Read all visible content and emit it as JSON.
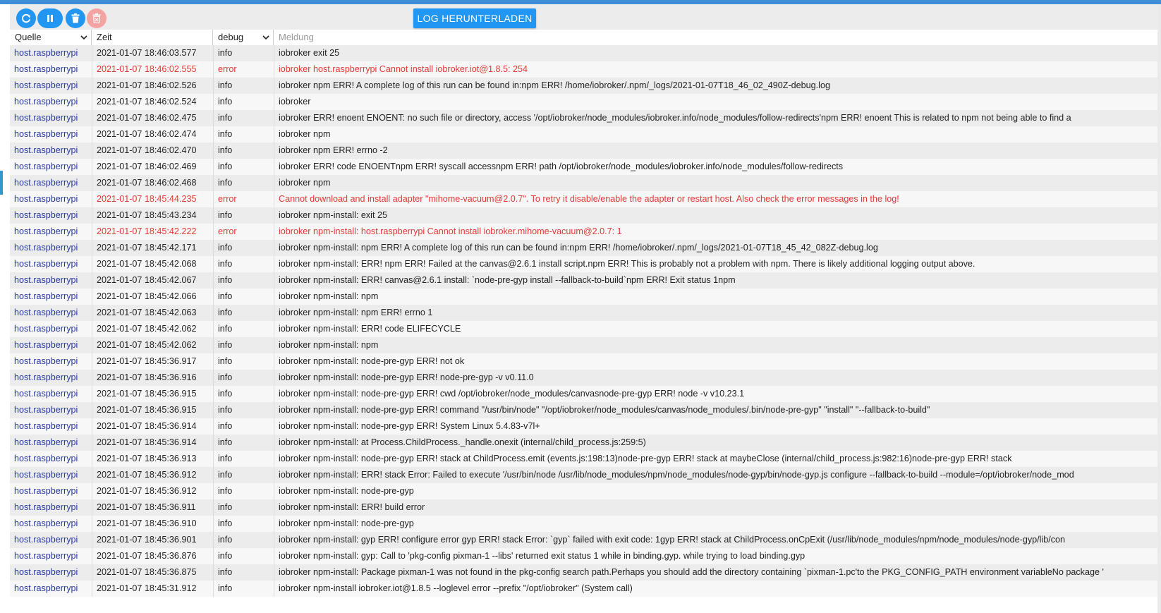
{
  "toolbar": {
    "buttons": [
      {
        "name": "refresh",
        "icon": "refresh-icon"
      },
      {
        "name": "pause",
        "icon": "pause-icon"
      },
      {
        "name": "delete",
        "icon": "trash-icon"
      },
      {
        "name": "delete-file",
        "icon": "trash-x-icon",
        "disabled": true
      }
    ],
    "download_label": "LOG HERUNTERLADEN"
  },
  "table": {
    "columns": {
      "source": "Quelle",
      "time": "Zeit",
      "severity": "debug",
      "message_placeholder": "Meldung"
    },
    "rows": [
      {
        "source": "host.raspberrypi",
        "time": "2021-01-07 18:46:03.577",
        "severity": "info",
        "message": "iobroker exit 25"
      },
      {
        "source": "host.raspberrypi",
        "time": "2021-01-07 18:46:02.555",
        "severity": "error",
        "message": "iobroker host.raspberrypi Cannot install iobroker.iot@1.8.5: 254"
      },
      {
        "source": "host.raspberrypi",
        "time": "2021-01-07 18:46:02.526",
        "severity": "info",
        "message": "iobroker npm ERR! A complete log of this run can be found in:npm ERR! /home/iobroker/.npm/_logs/2021-01-07T18_46_02_490Z-debug.log"
      },
      {
        "source": "host.raspberrypi",
        "time": "2021-01-07 18:46:02.524",
        "severity": "info",
        "message": "iobroker"
      },
      {
        "source": "host.raspberrypi",
        "time": "2021-01-07 18:46:02.475",
        "severity": "info",
        "message": "iobroker ERR! enoent ENOENT: no such file or directory, access '/opt/iobroker/node_modules/iobroker.info/node_modules/follow-redirects'npm ERR! enoent This is related to npm not being able to find a"
      },
      {
        "source": "host.raspberrypi",
        "time": "2021-01-07 18:46:02.474",
        "severity": "info",
        "message": "iobroker npm"
      },
      {
        "source": "host.raspberrypi",
        "time": "2021-01-07 18:46:02.470",
        "severity": "info",
        "message": "iobroker npm ERR! errno -2"
      },
      {
        "source": "host.raspberrypi",
        "time": "2021-01-07 18:46:02.469",
        "severity": "info",
        "message": "iobroker ERR! code ENOENTnpm ERR! syscall accessnpm ERR! path /opt/iobroker/node_modules/iobroker.info/node_modules/follow-redirects"
      },
      {
        "source": "host.raspberrypi",
        "time": "2021-01-07 18:46:02.468",
        "severity": "info",
        "message": "iobroker npm"
      },
      {
        "source": "host.raspberrypi",
        "time": "2021-01-07 18:45:44.235",
        "severity": "error",
        "message": "Cannot download and install adapter \"mihome-vacuum@2.0.7\". To retry it disable/enable the adapter or restart host. Also check the error messages in the log!"
      },
      {
        "source": "host.raspberrypi",
        "time": "2021-01-07 18:45:43.234",
        "severity": "info",
        "message": "iobroker npm-install: exit 25"
      },
      {
        "source": "host.raspberrypi",
        "time": "2021-01-07 18:45:42.222",
        "severity": "error",
        "message": "iobroker npm-install: host.raspberrypi Cannot install iobroker.mihome-vacuum@2.0.7: 1"
      },
      {
        "source": "host.raspberrypi",
        "time": "2021-01-07 18:45:42.171",
        "severity": "info",
        "message": "iobroker npm-install: npm ERR! A complete log of this run can be found in:npm ERR! /home/iobroker/.npm/_logs/2021-01-07T18_45_42_082Z-debug.log"
      },
      {
        "source": "host.raspberrypi",
        "time": "2021-01-07 18:45:42.068",
        "severity": "info",
        "message": "iobroker npm-install: ERR! npm ERR! Failed at the canvas@2.6.1 install script.npm ERR! This is probably not a problem with npm. There is likely additional logging output above."
      },
      {
        "source": "host.raspberrypi",
        "time": "2021-01-07 18:45:42.067",
        "severity": "info",
        "message": "iobroker npm-install: ERR! canvas@2.6.1 install: `node-pre-gyp install --fallback-to-build`npm ERR! Exit status 1npm"
      },
      {
        "source": "host.raspberrypi",
        "time": "2021-01-07 18:45:42.066",
        "severity": "info",
        "message": "iobroker npm-install: npm"
      },
      {
        "source": "host.raspberrypi",
        "time": "2021-01-07 18:45:42.063",
        "severity": "info",
        "message": "iobroker npm-install: npm ERR! errno 1"
      },
      {
        "source": "host.raspberrypi",
        "time": "2021-01-07 18:45:42.062",
        "severity": "info",
        "message": "iobroker npm-install: ERR! code ELIFECYCLE"
      },
      {
        "source": "host.raspberrypi",
        "time": "2021-01-07 18:45:42.062",
        "severity": "info",
        "message": "iobroker npm-install: npm"
      },
      {
        "source": "host.raspberrypi",
        "time": "2021-01-07 18:45:36.917",
        "severity": "info",
        "message": "iobroker npm-install: node-pre-gyp ERR! not ok"
      },
      {
        "source": "host.raspberrypi",
        "time": "2021-01-07 18:45:36.916",
        "severity": "info",
        "message": "iobroker npm-install: node-pre-gyp ERR! node-pre-gyp -v v0.11.0"
      },
      {
        "source": "host.raspberrypi",
        "time": "2021-01-07 18:45:36.915",
        "severity": "info",
        "message": "iobroker npm-install: node-pre-gyp ERR! cwd /opt/iobroker/node_modules/canvasnode-pre-gyp ERR! node -v v10.23.1"
      },
      {
        "source": "host.raspberrypi",
        "time": "2021-01-07 18:45:36.915",
        "severity": "info",
        "message": "iobroker npm-install: node-pre-gyp ERR! command \"/usr/bin/node\" \"/opt/iobroker/node_modules/canvas/node_modules/.bin/node-pre-gyp\" \"install\" \"--fallback-to-build\""
      },
      {
        "source": "host.raspberrypi",
        "time": "2021-01-07 18:45:36.914",
        "severity": "info",
        "message": "iobroker npm-install: node-pre-gyp ERR! System Linux 5.4.83-v7l+"
      },
      {
        "source": "host.raspberrypi",
        "time": "2021-01-07 18:45:36.914",
        "severity": "info",
        "message": "iobroker npm-install: at Process.ChildProcess._handle.onexit (internal/child_process.js:259:5)"
      },
      {
        "source": "host.raspberrypi",
        "time": "2021-01-07 18:45:36.913",
        "severity": "info",
        "message": "iobroker npm-install: node-pre-gyp ERR! stack at ChildProcess.emit (events.js:198:13)node-pre-gyp ERR! stack at maybeClose (internal/child_process.js:982:16)node-pre-gyp ERR! stack"
      },
      {
        "source": "host.raspberrypi",
        "time": "2021-01-07 18:45:36.912",
        "severity": "info",
        "message": "iobroker npm-install: ERR! stack Error: Failed to execute '/usr/bin/node /usr/lib/node_modules/npm/node_modules/node-gyp/bin/node-gyp.js configure --fallback-to-build --module=/opt/iobroker/node_mod"
      },
      {
        "source": "host.raspberrypi",
        "time": "2021-01-07 18:45:36.912",
        "severity": "info",
        "message": "iobroker npm-install: node-pre-gyp"
      },
      {
        "source": "host.raspberrypi",
        "time": "2021-01-07 18:45:36.911",
        "severity": "info",
        "message": "iobroker npm-install: ERR! build error"
      },
      {
        "source": "host.raspberrypi",
        "time": "2021-01-07 18:45:36.910",
        "severity": "info",
        "message": "iobroker npm-install: node-pre-gyp"
      },
      {
        "source": "host.raspberrypi",
        "time": "2021-01-07 18:45:36.901",
        "severity": "info",
        "message": "iobroker npm-install: gyp ERR! configure error gyp ERR! stack Error: `gyp` failed with exit code: 1gyp ERR! stack at ChildProcess.onCpExit (/usr/lib/node_modules/npm/node_modules/node-gyp/lib/con"
      },
      {
        "source": "host.raspberrypi",
        "time": "2021-01-07 18:45:36.876",
        "severity": "info",
        "message": "iobroker npm-install: gyp: Call to 'pkg-config pixman-1 --libs' returned exit status 1 while in binding.gyp. while trying to load binding.gyp"
      },
      {
        "source": "host.raspberrypi",
        "time": "2021-01-07 18:45:36.875",
        "severity": "info",
        "message": "iobroker npm-install: Package pixman-1 was not found in the pkg-config search path.Perhaps you should add the directory containing `pixman-1.pc'to the PKG_CONFIG_PATH environment variableNo package '"
      },
      {
        "source": "host.raspberrypi",
        "time": "2021-01-07 18:45:31.912",
        "severity": "info",
        "message": "iobroker npm-install iobroker.iot@1.8.5 --loglevel error --prefix \"/opt/iobroker\" (System call)"
      }
    ]
  },
  "colors": {
    "accent": "#2196f3",
    "error_text": "#e53935",
    "source_link": "#2a3aa0",
    "disabled_button": "#f4a3a3"
  }
}
